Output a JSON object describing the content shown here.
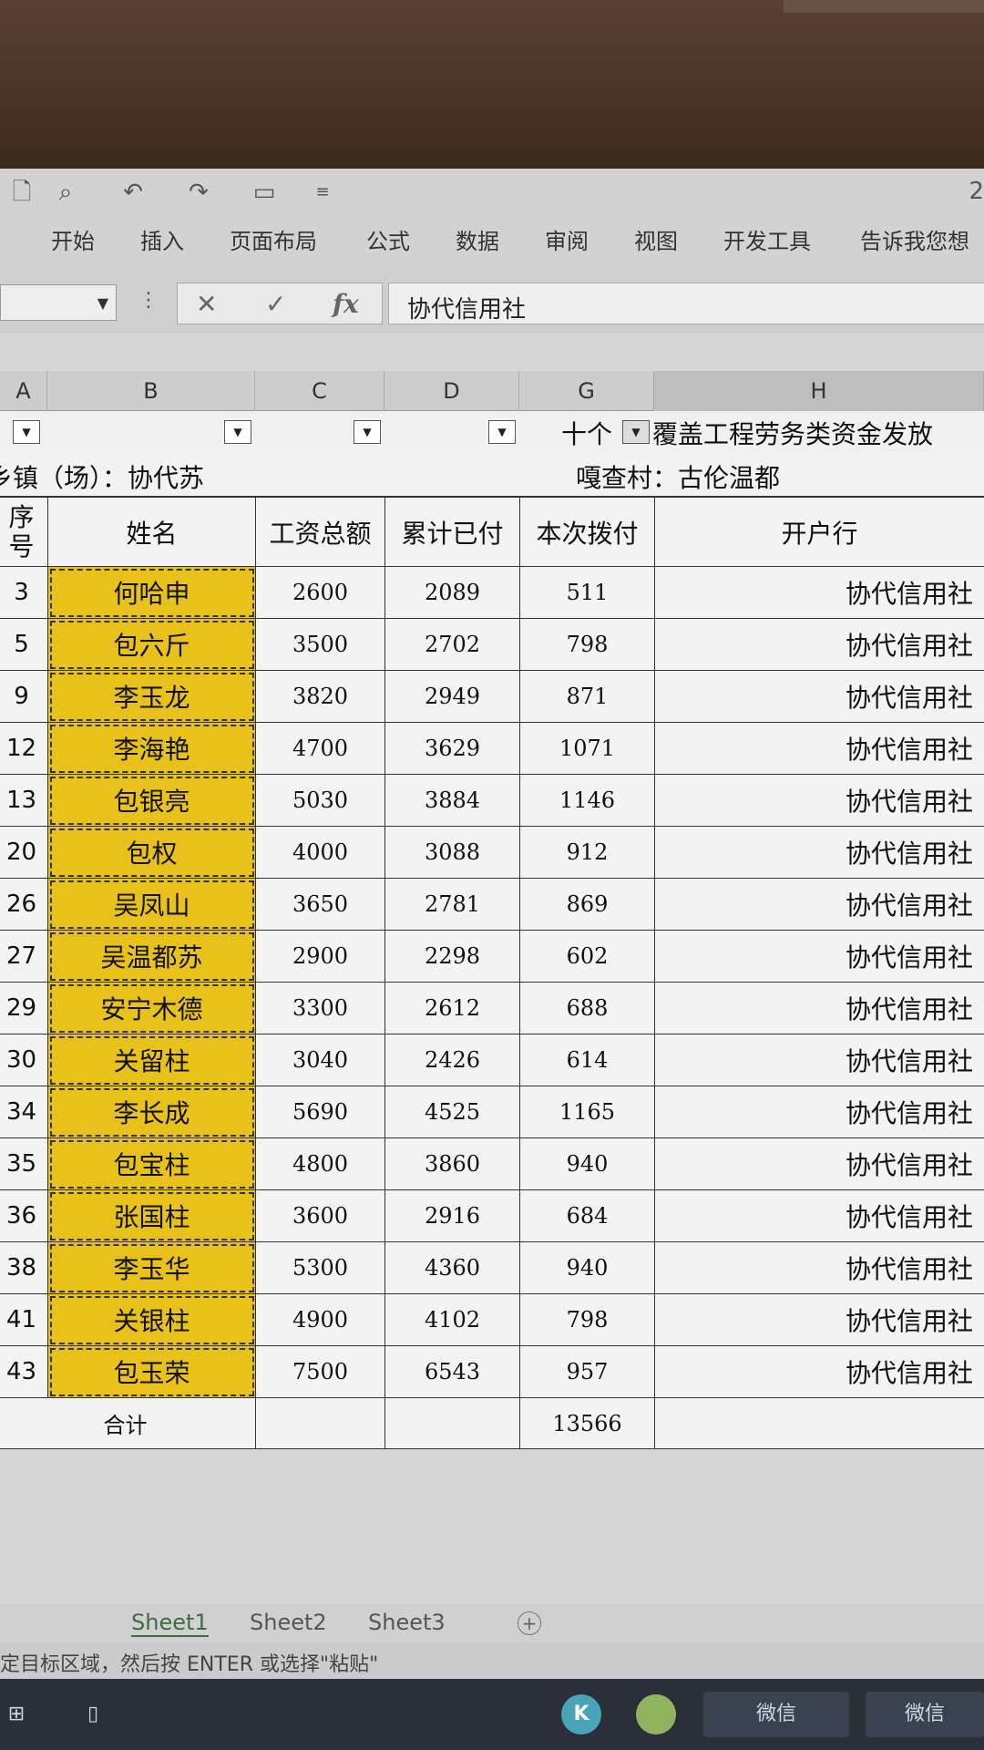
{
  "ribbon": {
    "version_fragment": "2",
    "tabs": [
      "开始",
      "插入",
      "页面布局",
      "公式",
      "数据",
      "审阅",
      "视图",
      "开发工具",
      "告诉我您想"
    ]
  },
  "formula_bar": {
    "cancel_icon": "✕",
    "enter_icon": "✓",
    "fx_label": "fx",
    "value": "协代信用社"
  },
  "columns": [
    "A",
    "B",
    "C",
    "D",
    "G",
    "H"
  ],
  "filter_row": {
    "title_prefix": "十个",
    "title": "覆盖工程劳务类资金发放"
  },
  "info_row": {
    "township": "乡镇（场）：协代苏",
    "village": "嘎查村：古伦温都"
  },
  "table": {
    "headers": {
      "seq": "序号",
      "name": "姓名",
      "total": "工资总额",
      "paid": "累计已付",
      "current": "本次拨付",
      "bank": "开户行"
    },
    "rows": [
      {
        "seq": "3",
        "name": "何哈申",
        "total": "2600",
        "paid": "2089",
        "current": "511",
        "bank": "协代信用社"
      },
      {
        "seq": "5",
        "name": "包六斤",
        "total": "3500",
        "paid": "2702",
        "current": "798",
        "bank": "协代信用社"
      },
      {
        "seq": "9",
        "name": "李玉龙",
        "total": "3820",
        "paid": "2949",
        "current": "871",
        "bank": "协代信用社"
      },
      {
        "seq": "12",
        "name": "李海艳",
        "total": "4700",
        "paid": "3629",
        "current": "1071",
        "bank": "协代信用社"
      },
      {
        "seq": "13",
        "name": "包银亮",
        "total": "5030",
        "paid": "3884",
        "current": "1146",
        "bank": "协代信用社"
      },
      {
        "seq": "20",
        "name": "包权",
        "total": "4000",
        "paid": "3088",
        "current": "912",
        "bank": "协代信用社"
      },
      {
        "seq": "26",
        "name": "吴凤山",
        "total": "3650",
        "paid": "2781",
        "current": "869",
        "bank": "协代信用社"
      },
      {
        "seq": "27",
        "name": "吴温都苏",
        "total": "2900",
        "paid": "2298",
        "current": "602",
        "bank": "协代信用社"
      },
      {
        "seq": "29",
        "name": "安宁木德",
        "total": "3300",
        "paid": "2612",
        "current": "688",
        "bank": "协代信用社"
      },
      {
        "seq": "30",
        "name": "关留柱",
        "total": "3040",
        "paid": "2426",
        "current": "614",
        "bank": "协代信用社"
      },
      {
        "seq": "34",
        "name": "李长成",
        "total": "5690",
        "paid": "4525",
        "current": "1165",
        "bank": "协代信用社"
      },
      {
        "seq": "35",
        "name": "包宝柱",
        "total": "4800",
        "paid": "3860",
        "current": "940",
        "bank": "协代信用社"
      },
      {
        "seq": "36",
        "name": "张国柱",
        "total": "3600",
        "paid": "2916",
        "current": "684",
        "bank": "协代信用社"
      },
      {
        "seq": "38",
        "name": "李玉华",
        "total": "5300",
        "paid": "4360",
        "current": "940",
        "bank": "协代信用社"
      },
      {
        "seq": "41",
        "name": "关银柱",
        "total": "4900",
        "paid": "4102",
        "current": "798",
        "bank": "协代信用社"
      },
      {
        "seq": "43",
        "name": "包玉荣",
        "total": "7500",
        "paid": "6543",
        "current": "957",
        "bank": "协代信用社"
      }
    ],
    "total_label": "合计",
    "total_current": "13566"
  },
  "sheets": [
    "Sheet1",
    "Sheet2",
    "Sheet3"
  ],
  "add_sheet_icon": "+",
  "status_text": "定目标区域，然后按 ENTER 或选择\"粘贴\"",
  "taskbar": {
    "items": [
      "微信",
      "微信"
    ],
    "k_label": "K"
  },
  "colors": {
    "highlight": "#e8c21a",
    "accent_green": "#3a6f3a"
  }
}
